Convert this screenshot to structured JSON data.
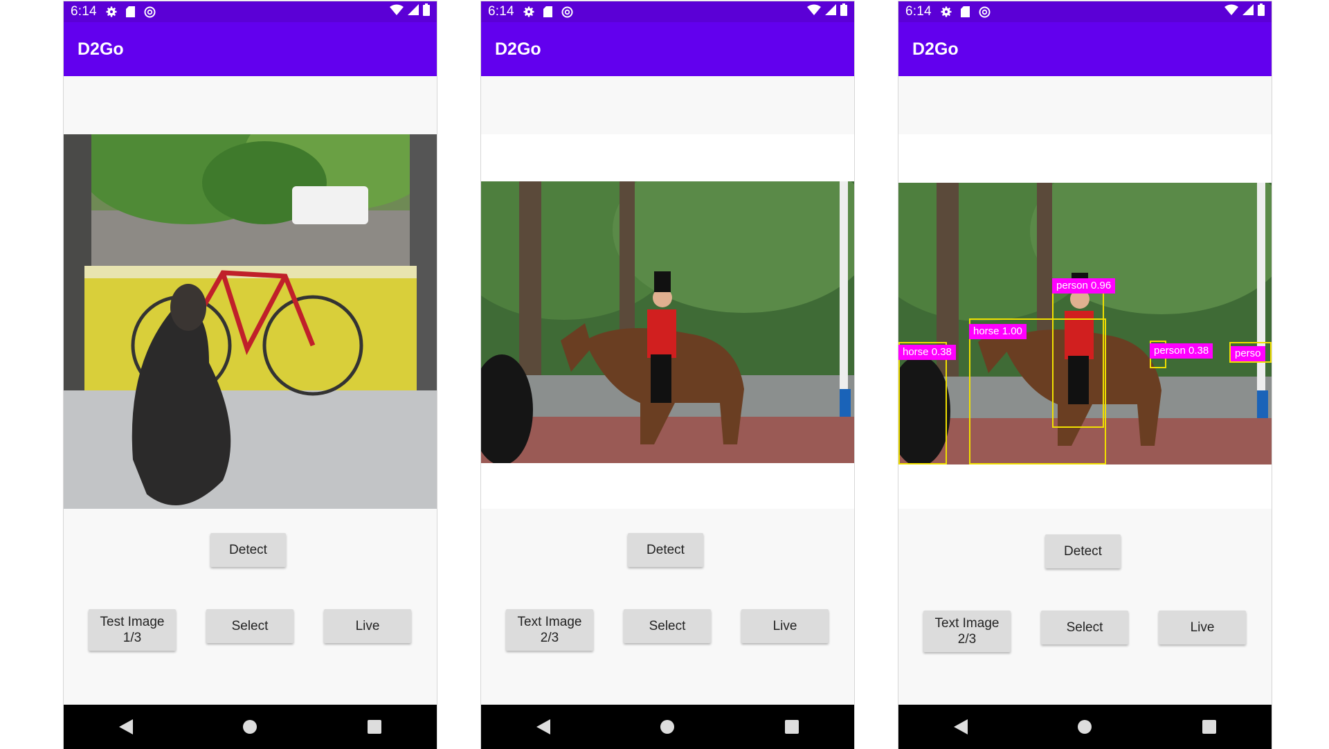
{
  "status": {
    "time": "6:14"
  },
  "app": {
    "title": "D2Go"
  },
  "phones": [
    {
      "detect_label": "Detect",
      "test_label_line1": "Test Image",
      "test_label_line2": "1/3",
      "select_label": "Select",
      "live_label": "Live"
    },
    {
      "detect_label": "Detect",
      "test_label_line1": "Text Image",
      "test_label_line2": "2/3",
      "select_label": "Select",
      "live_label": "Live"
    },
    {
      "detect_label": "Detect",
      "test_label_line1": "Text Image",
      "test_label_line2": "2/3",
      "select_label": "Select",
      "live_label": "Live",
      "detections": [
        {
          "label": "person 0.96"
        },
        {
          "label": "horse 1.00"
        },
        {
          "label": "horse 0.38"
        },
        {
          "label": "person 0.38"
        },
        {
          "label": "perso"
        }
      ]
    }
  ],
  "colors": {
    "status_bar": "#5b00d6",
    "app_bar": "#6200ee",
    "label_bg": "#ff00ff",
    "box": "#f0e000"
  },
  "icons": [
    "gear-icon",
    "sd-card-icon",
    "at-icon",
    "wifi-icon",
    "signal-icon",
    "battery-icon",
    "back-icon",
    "home-icon",
    "recents-icon"
  ]
}
